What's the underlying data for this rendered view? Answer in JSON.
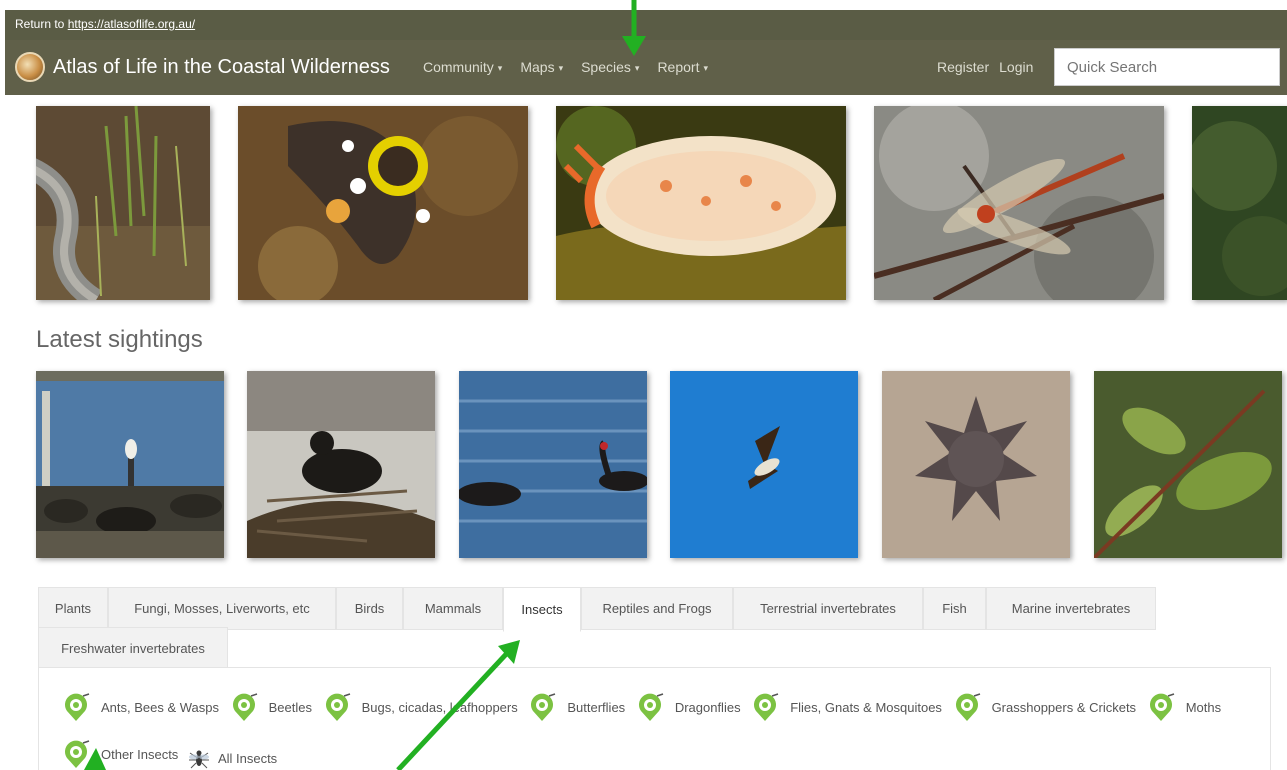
{
  "return_bar": {
    "prefix": "Return to ",
    "link_text": "https://atlasoflife.org.au/"
  },
  "header": {
    "brand": "Atlas of Life in the Coastal Wilderness",
    "menu": [
      {
        "label": "Community",
        "caret": "▾"
      },
      {
        "label": "Maps",
        "caret": "▾"
      },
      {
        "label": "Species",
        "caret": "▾"
      },
      {
        "label": "Report",
        "caret": "▾"
      }
    ],
    "register": "Register",
    "login": "Login",
    "search_placeholder": "Quick Search"
  },
  "latest_sightings_title": "Latest sightings",
  "tabs": [
    "Plants",
    "Fungi, Mosses, Liverworts, etc",
    "Birds",
    "Mammals",
    "Insects",
    "Reptiles and Frogs",
    "Terrestrial invertebrates",
    "Fish",
    "Marine invertebrates",
    "Freshwater invertebrates"
  ],
  "active_tab": "Insects",
  "insect_categories": [
    "Ants, Bees & Wasps",
    "Beetles",
    "Bugs, cicadas, leafhoppers",
    "Butterflies",
    "Dragonflies",
    "Flies, Gnats & Mosquitoes",
    "Grasshoppers & Crickets",
    "Moths",
    "Other Insects",
    "All Insects"
  ],
  "colors": {
    "navbar": "#606049",
    "pin": "#7cc242",
    "arrow": "#22b022"
  }
}
